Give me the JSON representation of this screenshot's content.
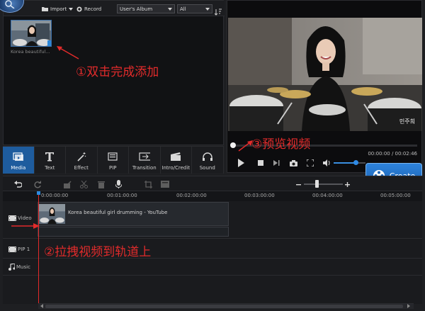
{
  "library": {
    "import_label": "Import",
    "record_label": "Record",
    "album_select": "User's Album",
    "filter_select": "All",
    "media_items": [
      {
        "label": "Korea beautiful..."
      }
    ]
  },
  "annotations": {
    "step1": "①双击完成添加",
    "step2": "②拉拽视频到轨道上",
    "step3": "③预览视频"
  },
  "categories": [
    {
      "label": "Media",
      "icon": "media-icon",
      "active": true
    },
    {
      "label": "Text",
      "icon": "text-icon",
      "active": false
    },
    {
      "label": "Effect",
      "icon": "effect-wand-icon",
      "active": false
    },
    {
      "label": "PIP",
      "icon": "pip-icon",
      "active": false
    },
    {
      "label": "Transition",
      "icon": "transition-icon",
      "active": false
    },
    {
      "label": "Intro/Credit",
      "icon": "intro-credit-icon",
      "active": false
    },
    {
      "label": "Sound",
      "icon": "headphones-icon",
      "active": false
    }
  ],
  "preview": {
    "time": "00:00:00 / 00:02:46",
    "overlay_text": "민주희",
    "volume_level_percent": 65
  },
  "create_button": {
    "label": "Create"
  },
  "timeline": {
    "ruler": [
      "0:00:00:00",
      "00:01:00:00",
      "00:02:00:00",
      "00:03:00:00",
      "00:04:00:00",
      "00:05:00:00"
    ],
    "tracks": [
      {
        "label": "Video",
        "icon": "film-icon"
      },
      {
        "label": "PIP 1",
        "icon": "film-icon"
      },
      {
        "label": "Music",
        "icon": "music-note-icon"
      }
    ],
    "clip_label": "Korea beautiful girl drumming - YouTube"
  },
  "colors": {
    "accent": "#1e5c9e",
    "annotation": "#e22b2b",
    "playhead": "#e32a2a"
  }
}
